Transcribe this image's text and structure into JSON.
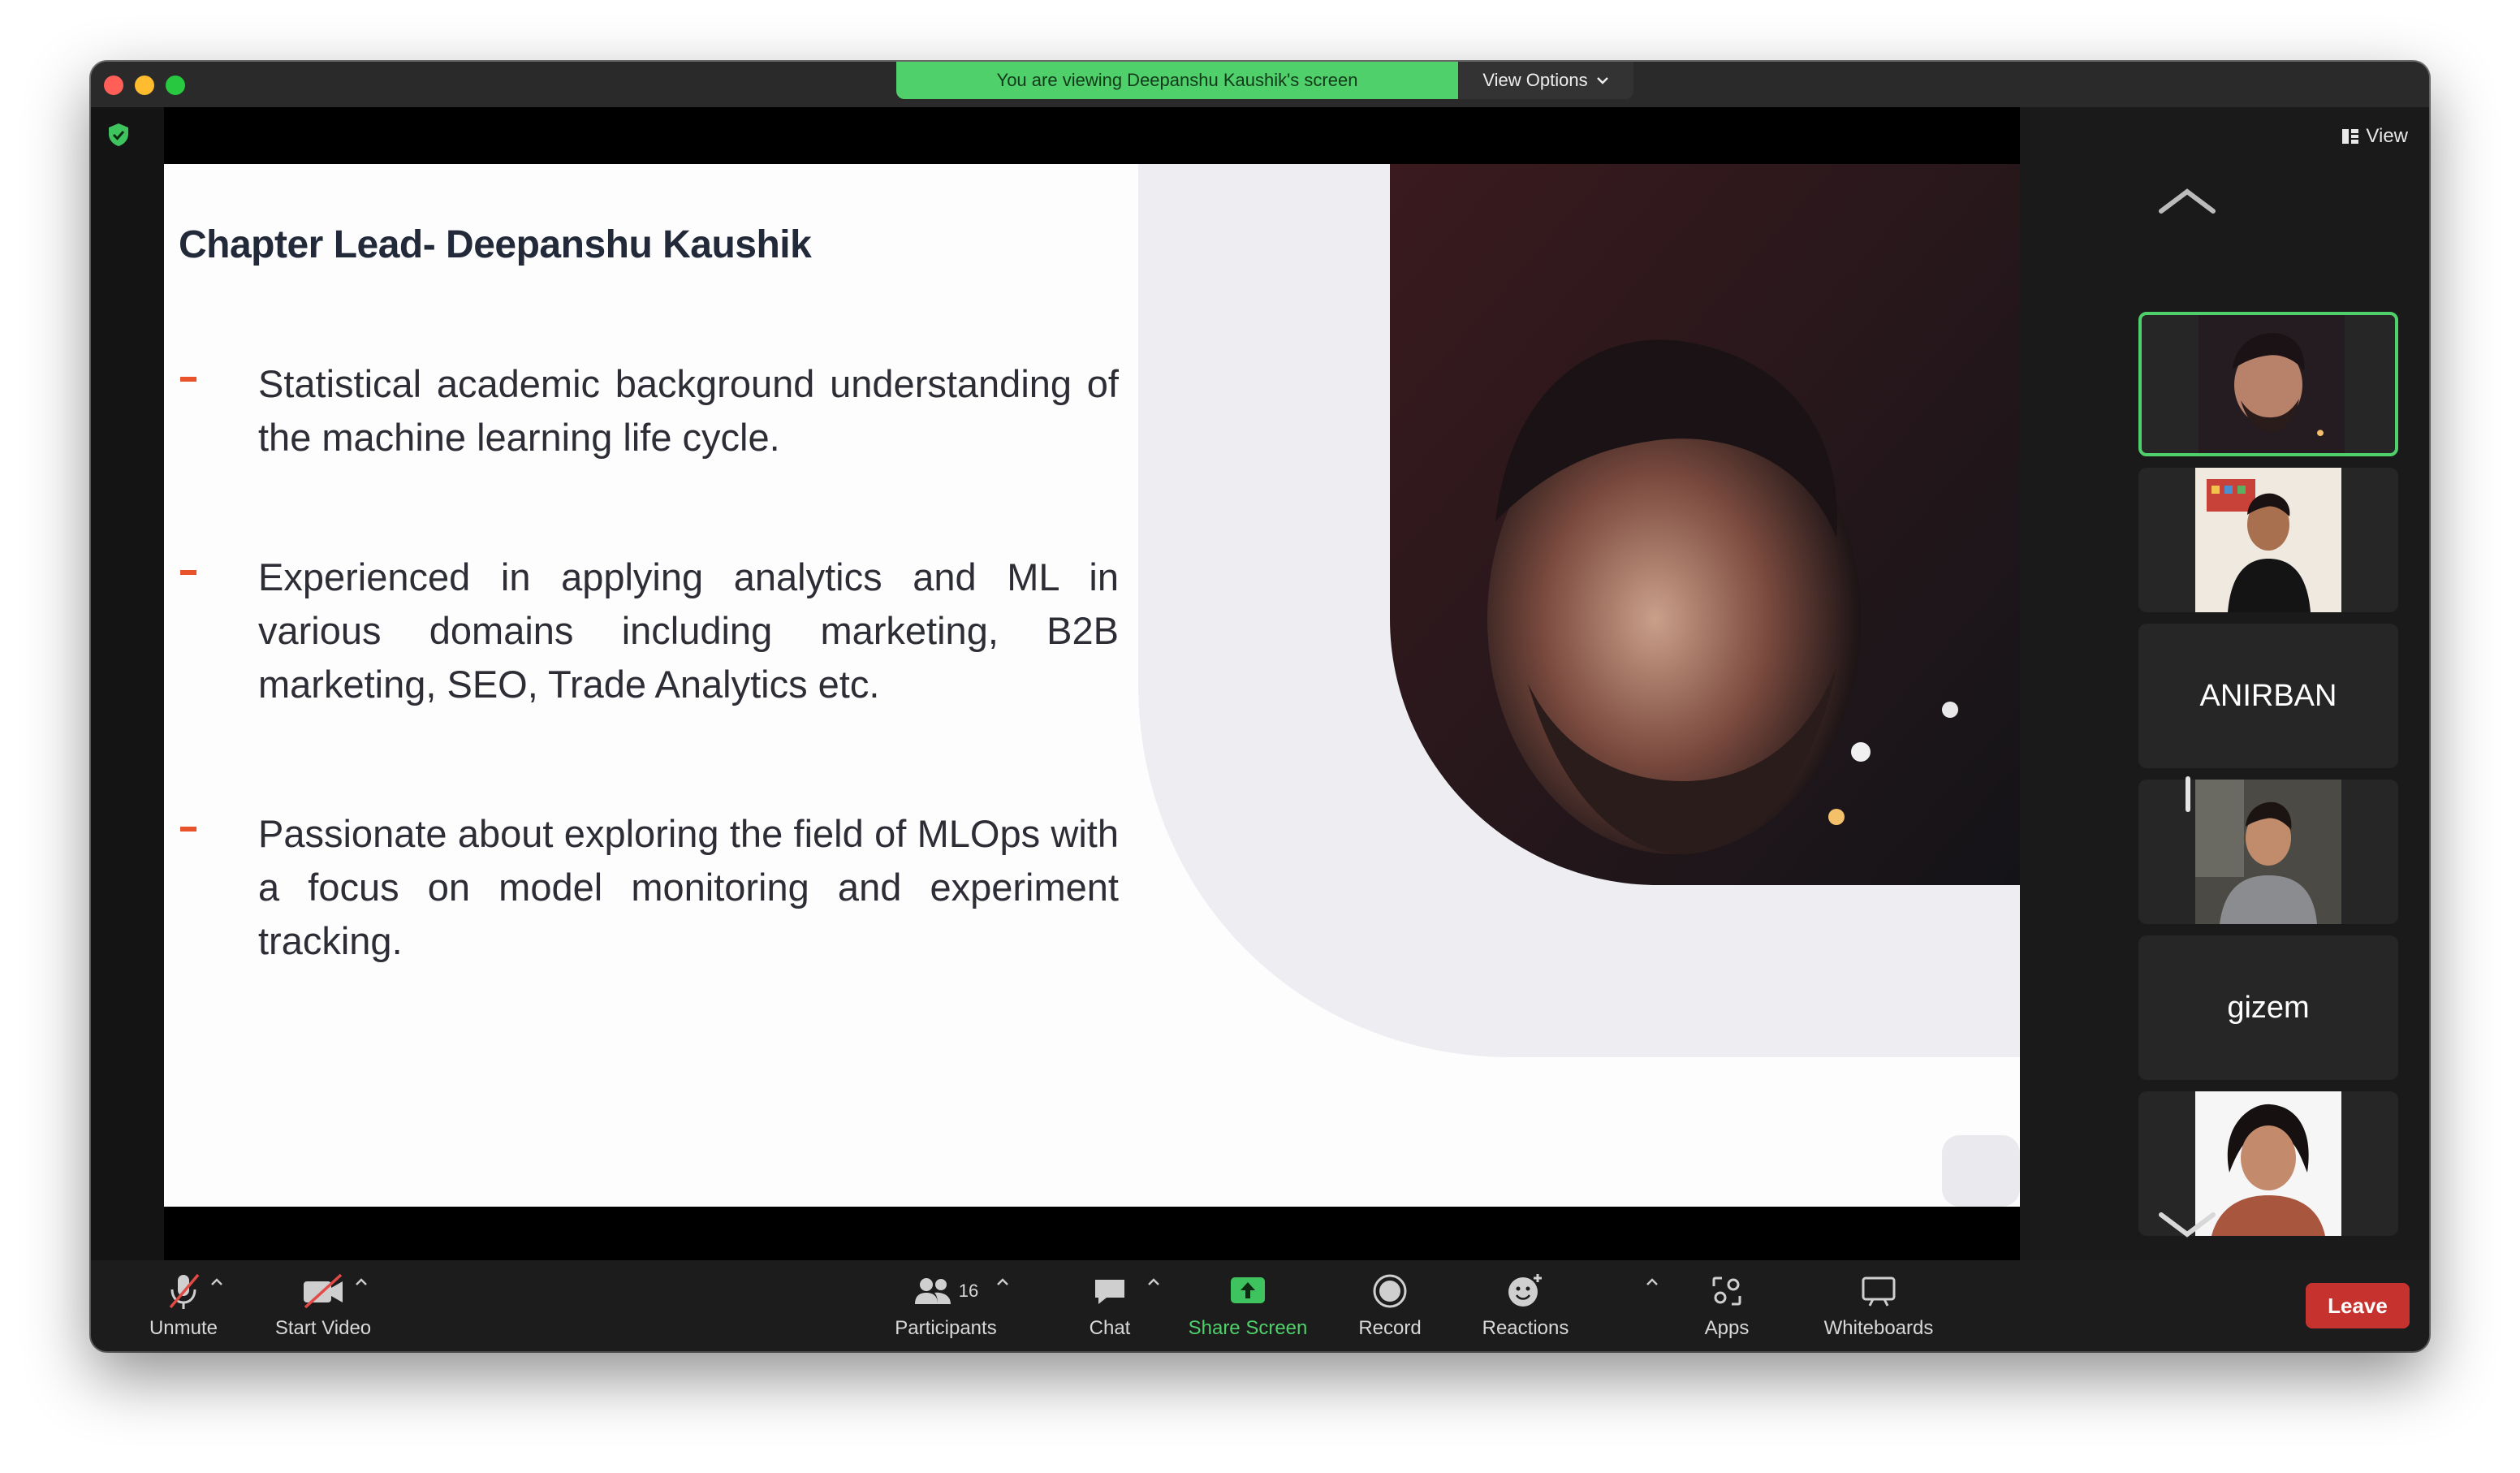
{
  "banner": {
    "viewing_text": "You are viewing Deepanshu Kaushik's screen",
    "view_options": "View Options"
  },
  "slide": {
    "title": "Chapter Lead- Deepanshu Kaushik",
    "bullets": [
      "Statistical academic background understanding of the machine learning life cycle.",
      "Experienced in applying analytics and ML in various domains including marketing, B2B marketing, SEO, Trade Analytics etc.",
      "Passionate about exploring the field of MLOps with a focus on model monitoring and experiment tracking."
    ]
  },
  "gallery": {
    "view_label": "View",
    "participants": [
      {
        "kind": "video",
        "active": true
      },
      {
        "kind": "video",
        "active": false
      },
      {
        "kind": "name",
        "name": "ANIRBAN"
      },
      {
        "kind": "video",
        "active": false
      },
      {
        "kind": "name",
        "name": "gizem"
      },
      {
        "kind": "video",
        "active": false
      }
    ]
  },
  "toolbar": {
    "unmute": "Unmute",
    "start_video": "Start Video",
    "participants": "Participants",
    "participants_count": "16",
    "chat": "Chat",
    "share_screen": "Share Screen",
    "record": "Record",
    "reactions": "Reactions",
    "apps": "Apps",
    "whiteboards": "Whiteboards",
    "leave": "Leave"
  },
  "colors": {
    "accent_green": "#4fd06a",
    "leave_red": "#c6322e",
    "bullet_orange": "#e8532c"
  }
}
